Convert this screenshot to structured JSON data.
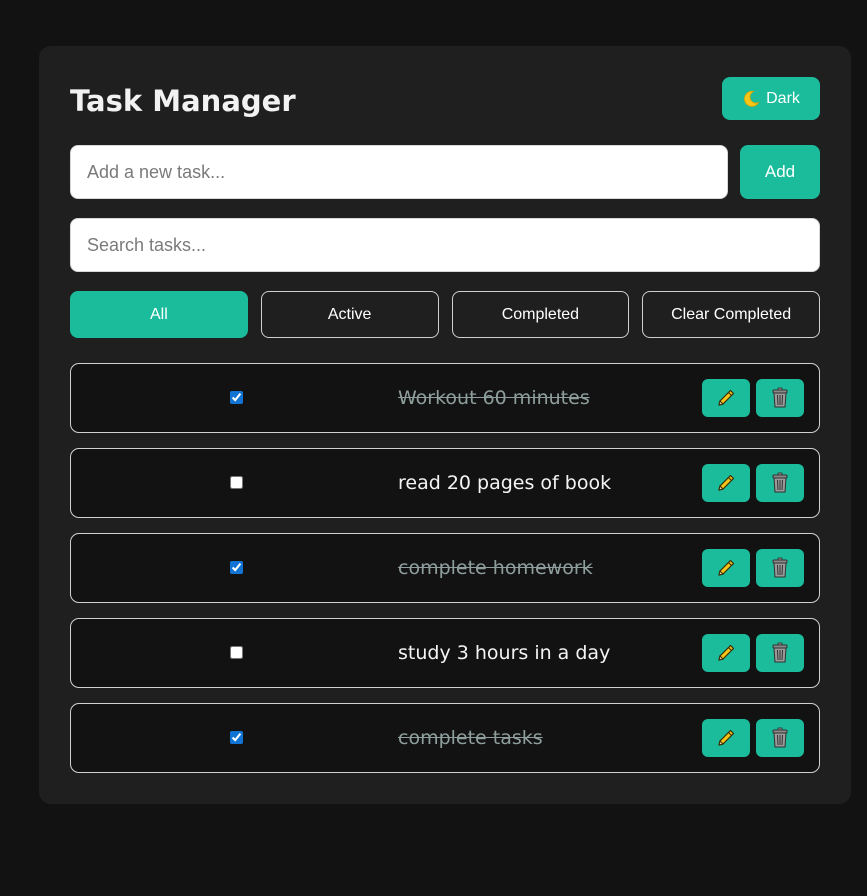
{
  "app": {
    "title": "Task Manager",
    "theme_toggle": {
      "icon": "moon-icon",
      "label": "Dark"
    }
  },
  "new_task": {
    "placeholder": "Add a new task...",
    "value": "",
    "add_label": "Add"
  },
  "search": {
    "placeholder": "Search tasks...",
    "value": ""
  },
  "filters": [
    {
      "label": "All",
      "active": true
    },
    {
      "label": "Active",
      "active": false
    },
    {
      "label": "Completed",
      "active": false
    },
    {
      "label": "Clear Completed",
      "active": false
    }
  ],
  "tasks": [
    {
      "text": "Workout 60 minutes",
      "completed": true,
      "edit_icon": "pencil-icon",
      "delete_icon": "trash-icon"
    },
    {
      "text": "read 20 pages of book",
      "completed": false,
      "edit_icon": "pencil-icon",
      "delete_icon": "trash-icon"
    },
    {
      "text": "complete homework",
      "completed": true,
      "edit_icon": "pencil-icon",
      "delete_icon": "trash-icon"
    },
    {
      "text": "study 3 hours in a day",
      "completed": false,
      "edit_icon": "pencil-icon",
      "delete_icon": "trash-icon"
    },
    {
      "text": "complete tasks",
      "completed": true,
      "edit_icon": "pencil-icon",
      "delete_icon": "trash-icon"
    }
  ],
  "colors": {
    "accent": "#1abc9c",
    "background": "#121212",
    "card": "#1f1f1f",
    "completed_text": "#8e9e9d",
    "checkbox": "#1173d4"
  }
}
